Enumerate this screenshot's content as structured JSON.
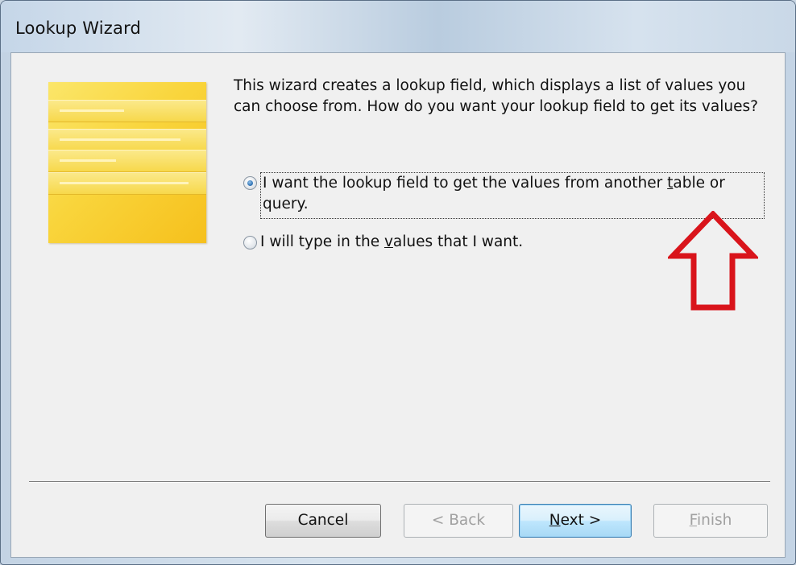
{
  "window": {
    "title": "Lookup Wizard"
  },
  "intro": {
    "text": "This wizard creates a lookup field, which displays a list of values you can choose from.  How do you want your lookup field to get its values?"
  },
  "options": [
    {
      "pre": "I want the lookup field to get the values from another ",
      "accel": "t",
      "post": "able or query.",
      "selected": true
    },
    {
      "pre": "I will type in the ",
      "accel": "v",
      "post": "alues that I want.",
      "selected": false
    }
  ],
  "buttons": {
    "cancel": "Cancel",
    "back": {
      "accel": "< B",
      "rest": "ack"
    },
    "next": {
      "accel": "N",
      "rest": "ext >"
    },
    "finish": {
      "accel": "F",
      "rest": "inish"
    }
  },
  "colors": {
    "annotation_arrow": "#d9141b",
    "illustration": "#f9d53c",
    "accent": "#3c7fb1"
  },
  "icons": {
    "illustration": "lookup-wizard-illustration",
    "annotation": "up-arrow-annotation"
  }
}
